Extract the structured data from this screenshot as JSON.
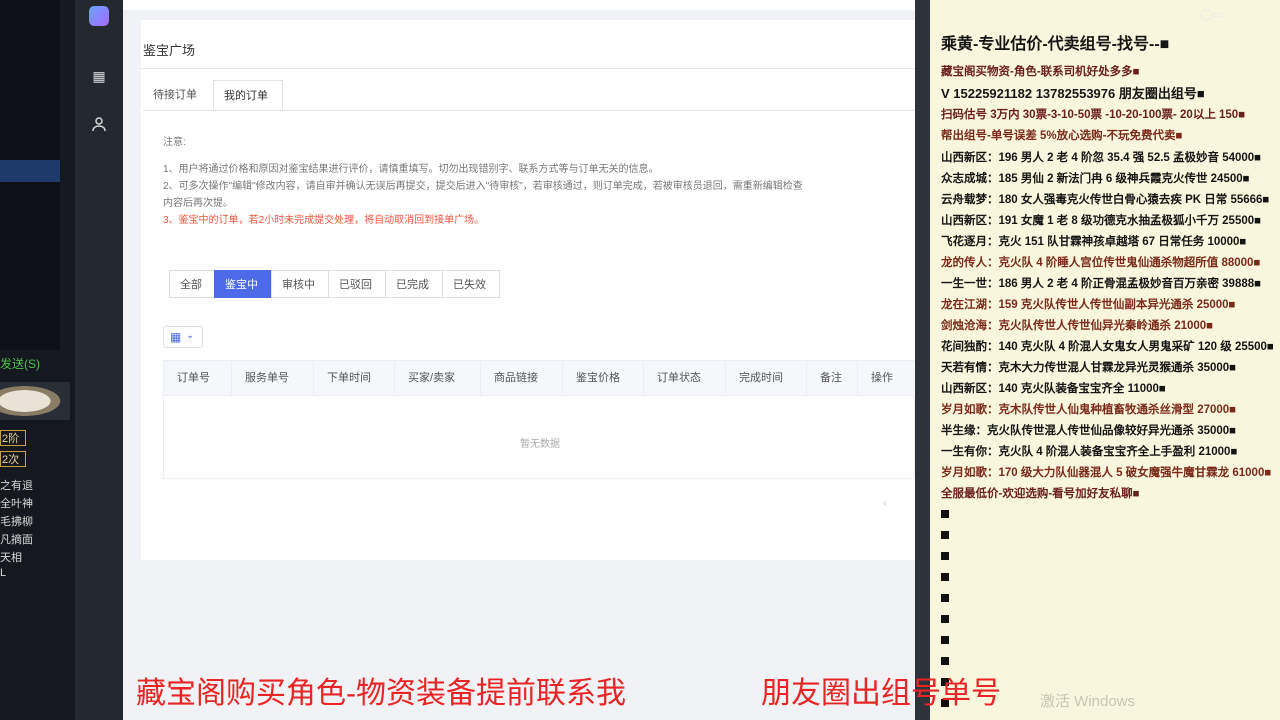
{
  "left_app": {
    "send_label": "发送(S)",
    "chips": [
      "2阶",
      "2次"
    ],
    "list": [
      "之有退",
      "全叶神",
      "毛拂柳",
      "凡摘面",
      "天相",
      "L"
    ]
  },
  "app": {
    "page_title": "鉴宝广场",
    "tabs": [
      {
        "label": "待接订单",
        "active": false
      },
      {
        "label": "我的订单",
        "active": true
      }
    ],
    "notice": {
      "heading": "注意:",
      "line1": "1、用户将通过价格和原因对鉴宝结果进行评价，请慎重填写。切勿出现错别字、联系方式等与订单无关的信息。",
      "line2": "2、可多次操作\"编辑\"修改内容，请自审并确认无误后再提交，提交后进入\"待审核\"，若审核通过，则订单完成，若被审核员退回，需重新编辑检查",
      "line2b": "内容后再次提。",
      "line3": "3、鉴宝中的订单，若2小时未完成提交处理，将自动取消回到接单广场。"
    },
    "filters": [
      {
        "label": "全部",
        "active": false
      },
      {
        "label": "鉴宝中",
        "active": true
      },
      {
        "label": "审核中",
        "active": false
      },
      {
        "label": "已驳回",
        "active": false
      },
      {
        "label": "已完成",
        "active": false
      },
      {
        "label": "已失效",
        "active": false
      }
    ],
    "columns": [
      "订单号",
      "服务单号",
      "下单时间",
      "买家/卖家",
      "商品链接",
      "鉴宝价格",
      "订单状态",
      "完成时间",
      "备注",
      "操作"
    ],
    "empty_text": "暂无数据",
    "icons": {
      "columns_toggle": "grid-icon",
      "caret": "chevron-down-icon"
    }
  },
  "chat": {
    "lines": [
      {
        "text": "乘黄-专业估价-代卖组号-找号--■",
        "style": "head"
      },
      {
        "text": "藏宝阁买物资-角色-联系司机好处多多■",
        "style": "dr"
      },
      {
        "text": "V 15225921182   13782553976 朋友圈出组号■",
        "style": "mid"
      },
      {
        "text": "扫码估号 3万内 30票-3-10-50票 -10-20-100票- 20以上 150■",
        "style": "dr"
      },
      {
        "text": "帮出组号-单号误差 5%放心选购-不玩免费代卖■",
        "style": "br"
      },
      {
        "text": "山西新区：196 男人 2 老 4 阶忽 35.4 强 52.5 孟极妙音 54000■",
        "style": ""
      },
      {
        "text": "众志成城：185 男仙 2 新法门冉 6 级神兵霞克火传世 24500■",
        "style": ""
      },
      {
        "text": "云舟载梦：180 女人强毒克火传世白骨心猿去疾 PK 日常 55666■",
        "style": ""
      },
      {
        "text": "山西新区：191 女魔 1 老 8 级功德克水抽孟极狐小千万 25500■",
        "style": ""
      },
      {
        "text": "飞花逐月：克火 151 队甘霖神孩卓越塔 67 日常任务 10000■",
        "style": ""
      },
      {
        "text": "龙的传人：克火队 4 阶睡人宫位传世鬼仙通杀物超所值 88000■",
        "style": "br"
      },
      {
        "text": "一生一世：186 男人 2 老 4 阶正骨混孟极妙音百万亲密 39888■",
        "style": ""
      },
      {
        "text": "龙在江湖：159 克火队传世人传世仙副本异光通杀 25000■",
        "style": "br"
      },
      {
        "text": "剑烛沧海：克火队传世人传世仙异光秦岭通杀 21000■",
        "style": "br"
      },
      {
        "text": "花间独酌：140 克火队 4 阶混人女鬼女人男鬼采矿 120 级 25500■",
        "style": ""
      },
      {
        "text": "天若有情：克木大力传世混人甘霖龙异光灵猴通杀 35000■",
        "style": ""
      },
      {
        "text": "山西新区：140 克火队装备宝宝齐全 11000■",
        "style": ""
      },
      {
        "text": "岁月如歌：克木队传世人仙鬼种植畜牧通杀丝滑型 27000■",
        "style": "br"
      },
      {
        "text": "半生缘：克火队传世混人传世仙品像较好异光通杀 35000■",
        "style": ""
      },
      {
        "text": "一生有你：克火队 4 阶混人装备宝宝齐全上手盈利 21000■",
        "style": ""
      },
      {
        "text": "岁月如歌：170 级大力队仙器混人 5 破女魔强牛魔甘霖龙 61000■",
        "style": "br"
      },
      {
        "text": "全服最低价-欢迎选购-看号加好友私聊■",
        "style": "dr"
      }
    ],
    "watermark": "激活 Windows"
  },
  "bottom_banner": {
    "left": "藏宝阁购买角色-物资装备提前联系我",
    "right": "朋友圈出组号单号"
  }
}
